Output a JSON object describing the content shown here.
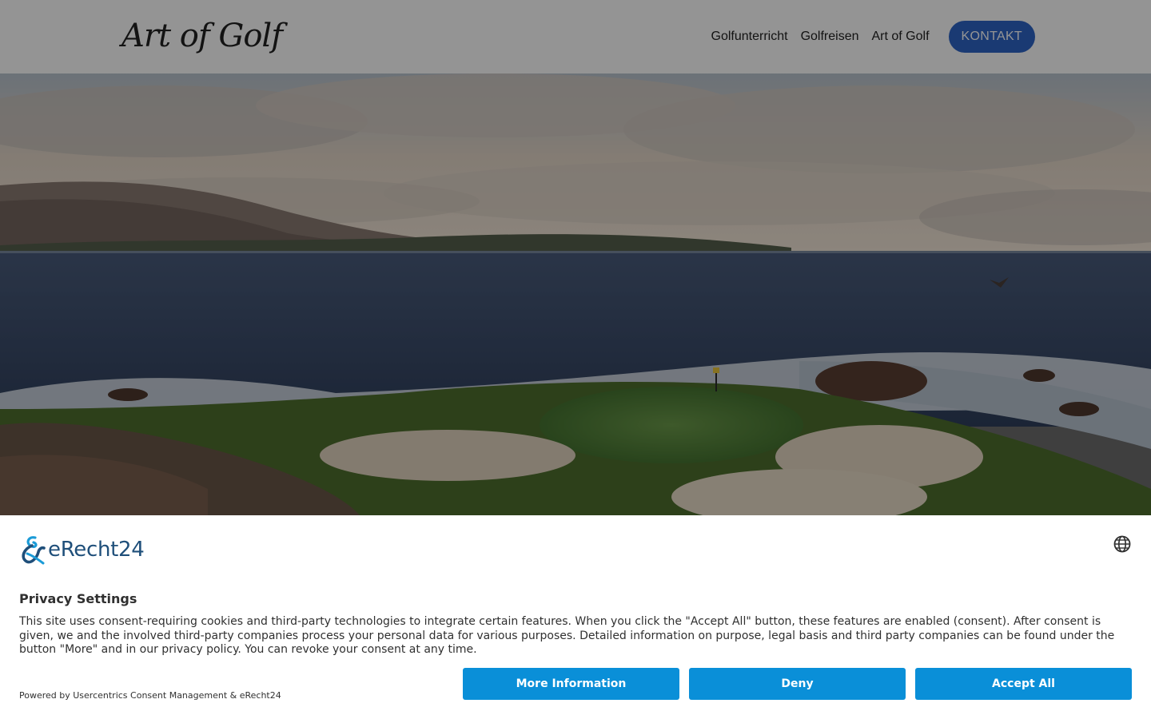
{
  "header": {
    "logo_text": "Art of Golf",
    "nav": [
      {
        "label": "Golfunterricht"
      },
      {
        "label": "Golfreisen"
      },
      {
        "label": "Art of Golf"
      }
    ],
    "cta_label": "KONTAKT"
  },
  "colors": {
    "accent": "#2d64c6",
    "consent_button": "#0a8fd8",
    "brand_text": "#1f4f7a"
  },
  "consent": {
    "brand_name": "eRecht24",
    "title": "Privacy Settings",
    "description": "This site uses consent-requiring cookies and third-party technologies to integrate certain features. When you click the \"Accept All\" button, these features are enabled (consent). After consent is given, we and the involved third-party companies process your personal data for various purposes. Detailed information on purpose, legal basis and third party companies can be found under the button \"More\" and in our privacy policy. You can revoke your consent at any time.",
    "powered_by": "Powered by Usercentrics Consent Management & eRecht24",
    "buttons": {
      "more": "More Information",
      "deny": "Deny",
      "accept": "Accept All"
    },
    "language_icon": "globe-icon"
  }
}
